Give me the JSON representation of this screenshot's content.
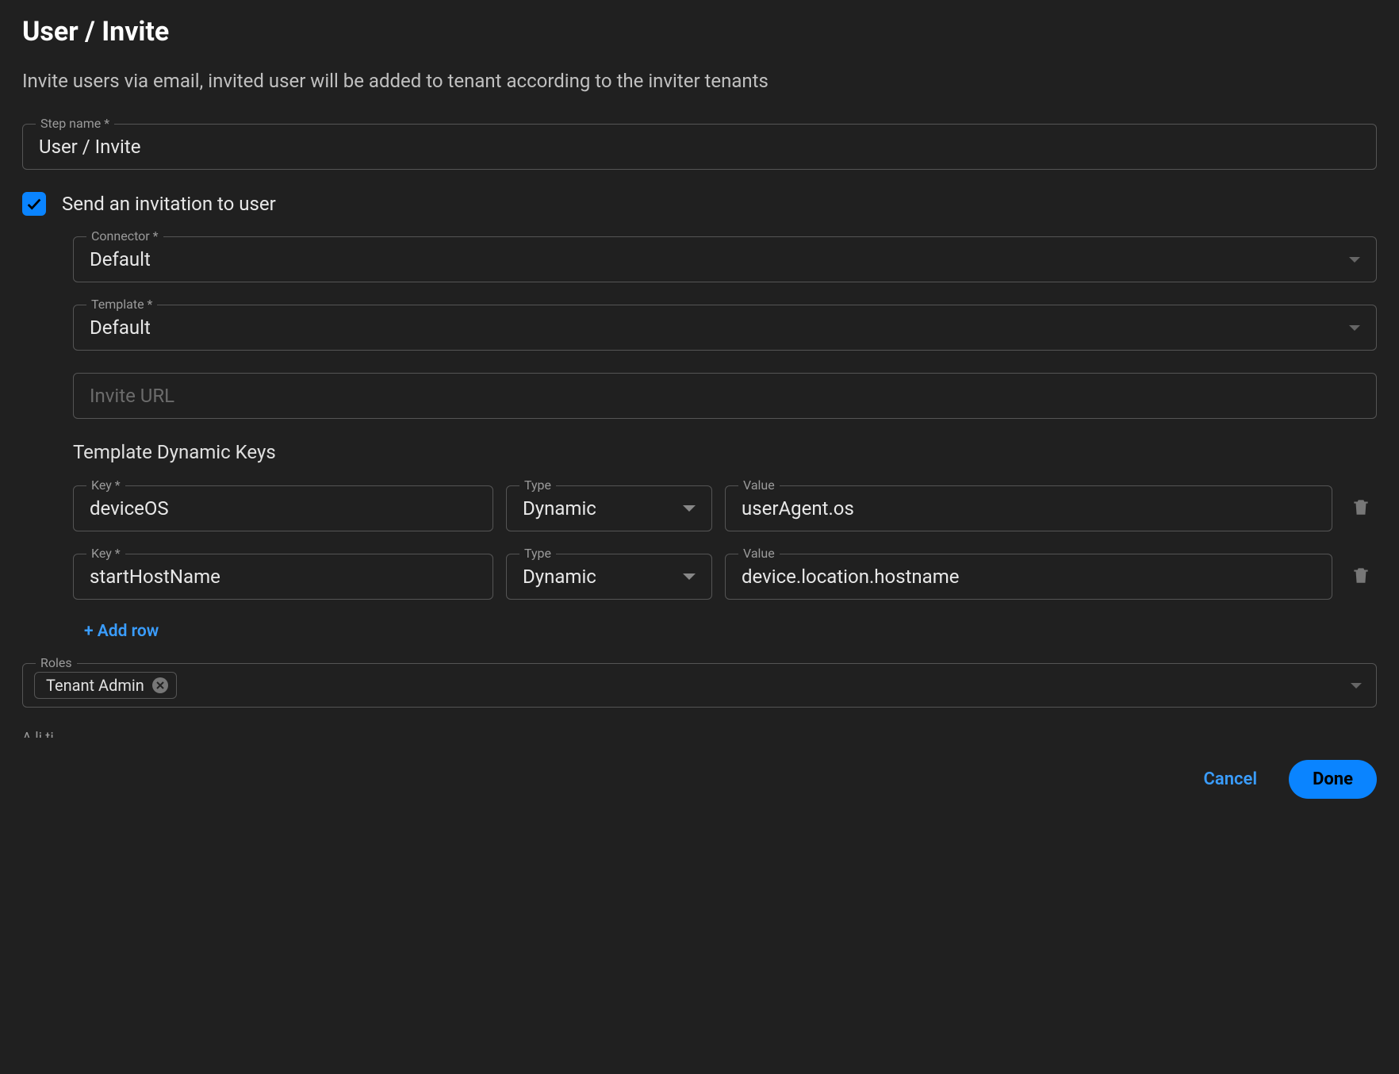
{
  "header": {
    "title": "User / Invite",
    "subtitle": "Invite users via email, invited user will be added to tenant according to the inviter tenants"
  },
  "step_name": {
    "label": "Step name *",
    "value": "User / Invite"
  },
  "send_invitation": {
    "checked": true,
    "label": "Send an invitation to user"
  },
  "connector": {
    "label": "Connector *",
    "value": "Default"
  },
  "template": {
    "label": "Template *",
    "value": "Default"
  },
  "invite_url": {
    "placeholder": "Invite URL",
    "value": ""
  },
  "dynamic_keys": {
    "heading": "Template Dynamic Keys",
    "key_label": "Key *",
    "type_label": "Type",
    "value_label": "Value",
    "rows": [
      {
        "key": "deviceOS",
        "type": "Dynamic",
        "value": "userAgent.os"
      },
      {
        "key": "startHostName",
        "type": "Dynamic",
        "value": "device.location.hostname"
      }
    ],
    "add_row_label": "+ Add row"
  },
  "roles": {
    "label": "Roles",
    "chips": [
      "Tenant Admin"
    ]
  },
  "truncated_next_label": "A     li    ti",
  "footer": {
    "cancel": "Cancel",
    "done": "Done"
  }
}
